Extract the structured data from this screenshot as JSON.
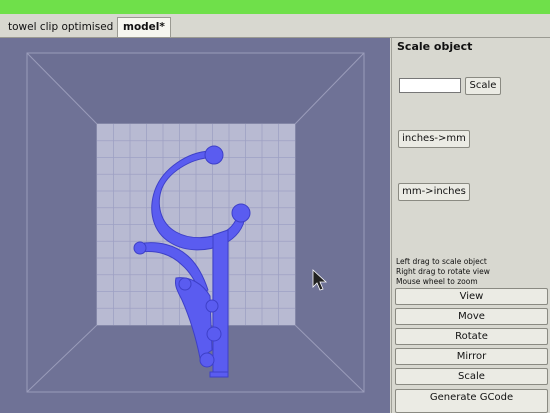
{
  "tabs": [
    {
      "label": "towel clip optimised",
      "active": false
    },
    {
      "label": "model*",
      "active": true
    }
  ],
  "panel": {
    "title": "Scale object",
    "scale_input_value": "",
    "scale_button": "Scale",
    "inches_to_mm_button": "inches->mm",
    "mm_to_inches_button": "mm->inches",
    "hints": [
      "Left drag to scale object",
      "Right drag to rotate view",
      "Mouse wheel to zoom"
    ]
  },
  "actions": {
    "view": "View",
    "move": "Move",
    "rotate": "Rotate",
    "mirror": "Mirror",
    "scale": "Scale",
    "generate_gcode": "Generate GCode"
  },
  "colors": {
    "top_bar": "#6fe04a",
    "viewport_bg": "#6f7296",
    "bed": "#b8bad2",
    "model": "#5a5cf0"
  },
  "viewport_icons": [
    "mouse-cursor-icon"
  ]
}
